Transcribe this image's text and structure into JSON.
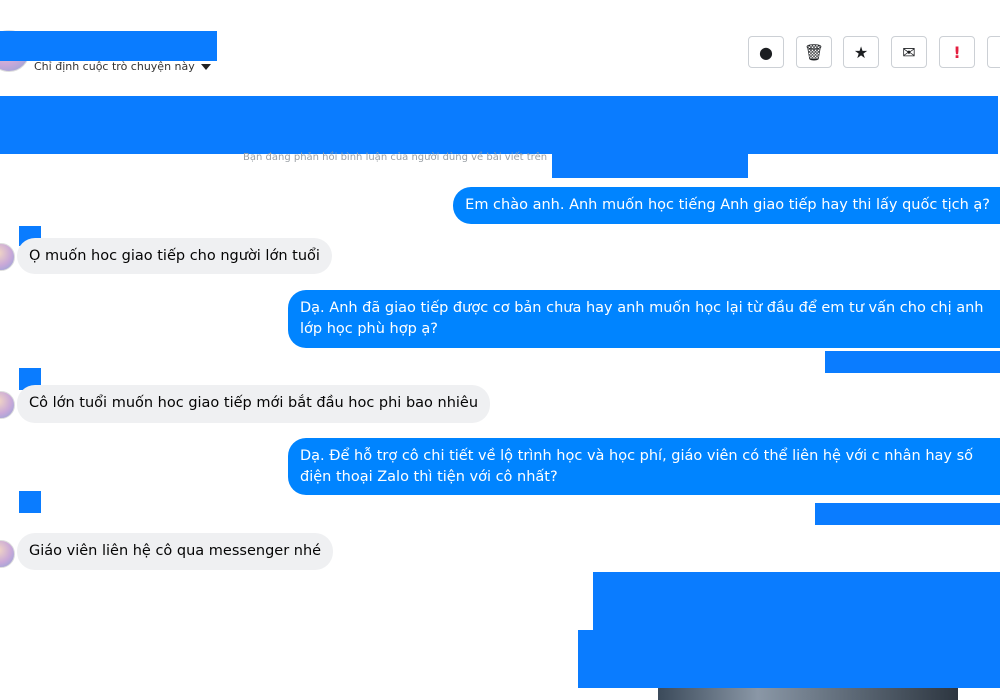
{
  "header": {
    "subtitle": "Chỉ định cuộc trò chuyện này",
    "toolbar": [
      {
        "icon": "info-icon",
        "glyph": "●"
      },
      {
        "icon": "trash-icon",
        "glyph": "🗑"
      },
      {
        "icon": "star-icon",
        "glyph": "★"
      },
      {
        "icon": "mail-icon",
        "glyph": "✉"
      },
      {
        "icon": "alert-icon",
        "glyph": "!"
      }
    ]
  },
  "notice": "Bạn đang phản hồi bình luận của người dùng về bài viết trên",
  "messages": [
    {
      "from": "page",
      "text": "Em chào anh. Anh muốn học tiếng Anh giao tiếp hay thi lấy quốc tịch ạ?"
    },
    {
      "from": "user",
      "text": "Ọ muốn hoc giao tiếp cho người lớn tuổi"
    },
    {
      "from": "page",
      "text": "Dạ. Anh đã giao tiếp được cơ bản chưa hay anh muốn học lại từ đầu để em tư vấn cho chị anh lớp học phù hợp ạ?"
    },
    {
      "from": "user",
      "text": "Cô lớn tuổi muốn hoc giao tiếp mới bắt đầu hoc phi bao nhiêu"
    },
    {
      "from": "page",
      "text": "Dạ. Để hỗ trợ cô chi tiết về lộ trình học và học phí, giáo viên có thể liên hệ với c nhân hay số điện thoại Zalo thì tiện với cô nhất?"
    },
    {
      "from": "user",
      "text": "Giáo viên liên hệ cô qua messenger nhé"
    }
  ],
  "colors": {
    "outgoing": "#0084ff",
    "incoming": "#eff0f2",
    "redaction": "#0a7cff"
  }
}
